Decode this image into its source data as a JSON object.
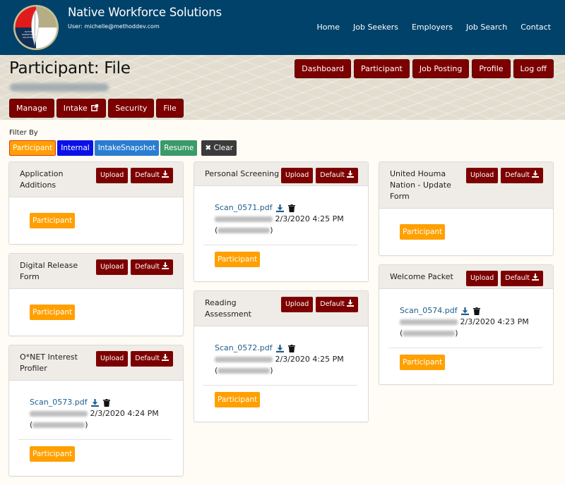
{
  "header": {
    "site_title": "Native Workforce Solutions",
    "user_line": "User: michelle@methoddev.com",
    "logo_icon": "native-workforce-logo",
    "nav": [
      "Home",
      "Job Seekers",
      "Employers",
      "Job Search",
      "Contact"
    ]
  },
  "page": {
    "title": "Participant: File",
    "top_actions": [
      "Dashboard",
      "Participant",
      "Job Posting",
      "Profile",
      "Log off"
    ],
    "sub_tabs": [
      {
        "label": "Manage"
      },
      {
        "label": "Intake",
        "icon": "external-link-icon"
      },
      {
        "label": "Security"
      },
      {
        "label": "File"
      }
    ]
  },
  "filter": {
    "label": "Filter By",
    "options": [
      {
        "label": "Participant",
        "color": "#ffa000",
        "active": true
      },
      {
        "label": "Internal",
        "color": "#0a10e8"
      },
      {
        "label": "IntakeSnapshot",
        "color": "#2a7dd1"
      },
      {
        "label": "Resume",
        "color": "#3a9a6a"
      }
    ],
    "clear_label": "Clear",
    "clear_icon": "x-icon"
  },
  "panel_buttons": {
    "upload": "Upload",
    "default": "Default",
    "default_icon": "download-icon"
  },
  "panels": {
    "application_additions": {
      "title": "Application Additions",
      "badge": "Participant"
    },
    "digital_release": {
      "title": "Digital Release Form",
      "badge": "Participant"
    },
    "onet": {
      "title": "O*NET Interest Profiler",
      "file": {
        "name": "Scan_0573.pdf",
        "timestamp": "2/3/2020 4:24 PM"
      },
      "badge": "Participant"
    },
    "personal_screening": {
      "title": "Personal Screening",
      "file": {
        "name": "Scan_0571.pdf",
        "timestamp": "2/3/2020 4:25 PM"
      },
      "badge": "Participant"
    },
    "reading_assessment": {
      "title": "Reading Assessment",
      "file": {
        "name": "Scan_0572.pdf",
        "timestamp": "2/3/2020 4:25 PM"
      },
      "badge": "Participant"
    },
    "united_houma": {
      "title": "United Houma Nation - Update Form",
      "badge": "Participant"
    },
    "welcome_packet": {
      "title": "Welcome Packet",
      "file": {
        "name": "Scan_0574.pdf",
        "timestamp": "2/3/2020 4:23 PM"
      },
      "badge": "Participant"
    }
  },
  "colors": {
    "header_bg": "#01426a",
    "button_red": "#7c0000",
    "badge_orange": "#ffa000",
    "link_blue": "#1f5d8c"
  }
}
